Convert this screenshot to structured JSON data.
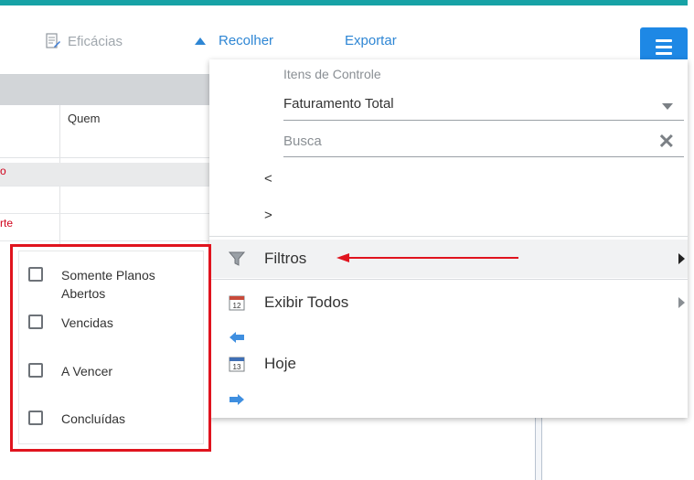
{
  "toolbar": {
    "eficacias_label": "Eficácias",
    "recolher_label": "Recolher",
    "exportar_label": "Exportar"
  },
  "table": {
    "header_quem": "Quem",
    "rows": [
      {
        "status_text": "o"
      },
      {
        "status_text": ""
      },
      {
        "status_text": "rte"
      }
    ]
  },
  "panel": {
    "itens_label": "Itens de Controle",
    "selected_item": "Faturamento Total",
    "search_placeholder": "Busca",
    "prev_label": "<",
    "next_label": ">",
    "menu": {
      "filtros": "Filtros",
      "exibir_todos": "Exibir Todos",
      "hoje": "Hoje"
    }
  },
  "filters": [
    {
      "label": "Somente Planos Abertos",
      "checked": false
    },
    {
      "label": "Vencidas",
      "checked": false
    },
    {
      "label": "A Vencer",
      "checked": false
    },
    {
      "label": "Concluídas",
      "checked": false
    }
  ],
  "colors": {
    "accent_blue": "#1e88e5",
    "link_blue": "#2e86d4",
    "top_bar_teal": "#17a2a6",
    "highlight_red": "#e0141e"
  }
}
